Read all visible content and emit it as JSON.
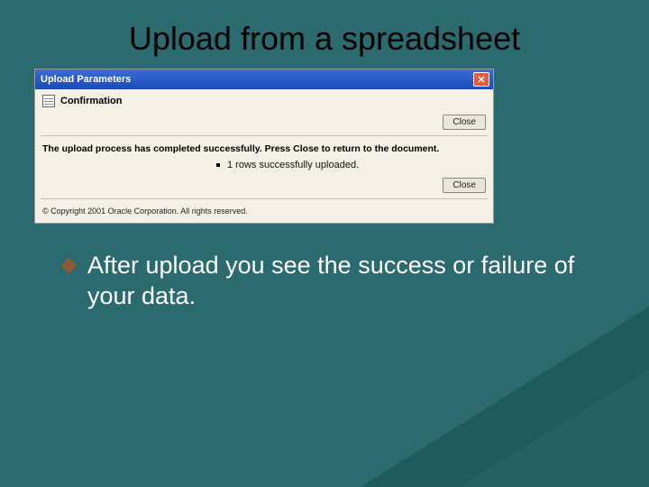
{
  "slide": {
    "title": "Upload from a spreadsheet"
  },
  "dialog": {
    "titlebar": "Upload Parameters",
    "close_glyph": "✕",
    "confirmation_label": "Confirmation",
    "close_btn_top": "Close",
    "message": "The upload process has completed successfully. Press Close to return to the document.",
    "rows_uploaded": "1 rows successfully uploaded.",
    "close_btn_bottom": "Close",
    "copyright": "© Copyright 2001 Oracle Corporation. All rights reserved."
  },
  "body": {
    "bullet_text": "After upload you see the success or failure of your data."
  }
}
